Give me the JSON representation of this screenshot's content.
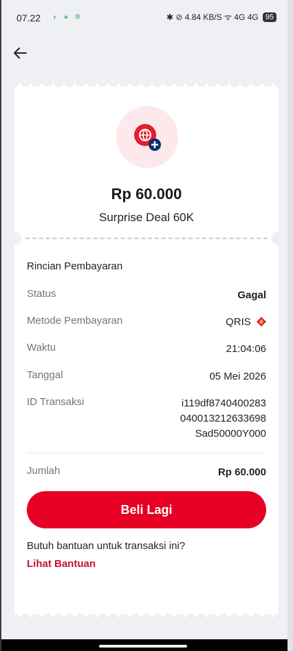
{
  "status_bar": {
    "time": "07.22",
    "left_icons": "◐ ● ✻",
    "right_icons": "✱ ⊘ 4.84 KB/S ᯤ 4G 4G",
    "battery": "95"
  },
  "header": {
    "back_icon": "arrow-left-icon"
  },
  "product": {
    "icon": "globe-plus-icon",
    "amount": "Rp 60.000",
    "name": "Surprise Deal 60K"
  },
  "details": {
    "title": "Rincian Pembayaran",
    "rows": [
      {
        "key": "Status",
        "value": "Gagal"
      },
      {
        "key": "Metode Pembayaran",
        "value": "QRIS"
      },
      {
        "key": "Waktu",
        "value": "21:04:06"
      },
      {
        "key": "Tanggal",
        "value": "05 Mei 2026"
      },
      {
        "key": "ID Transaksi",
        "value": "i119df8740400283\n040013212633698\nSad50000Y000"
      }
    ],
    "total_label": "Jumlah",
    "total_value": "Rp 60.000"
  },
  "actions": {
    "buy_again": "Beli Lagi",
    "help_text": "Butuh bantuan untuk transaksi ini?",
    "help_link": "Lihat Bantuan"
  },
  "colors": {
    "accent": "#e60023",
    "status_failed": "#c8102e"
  }
}
